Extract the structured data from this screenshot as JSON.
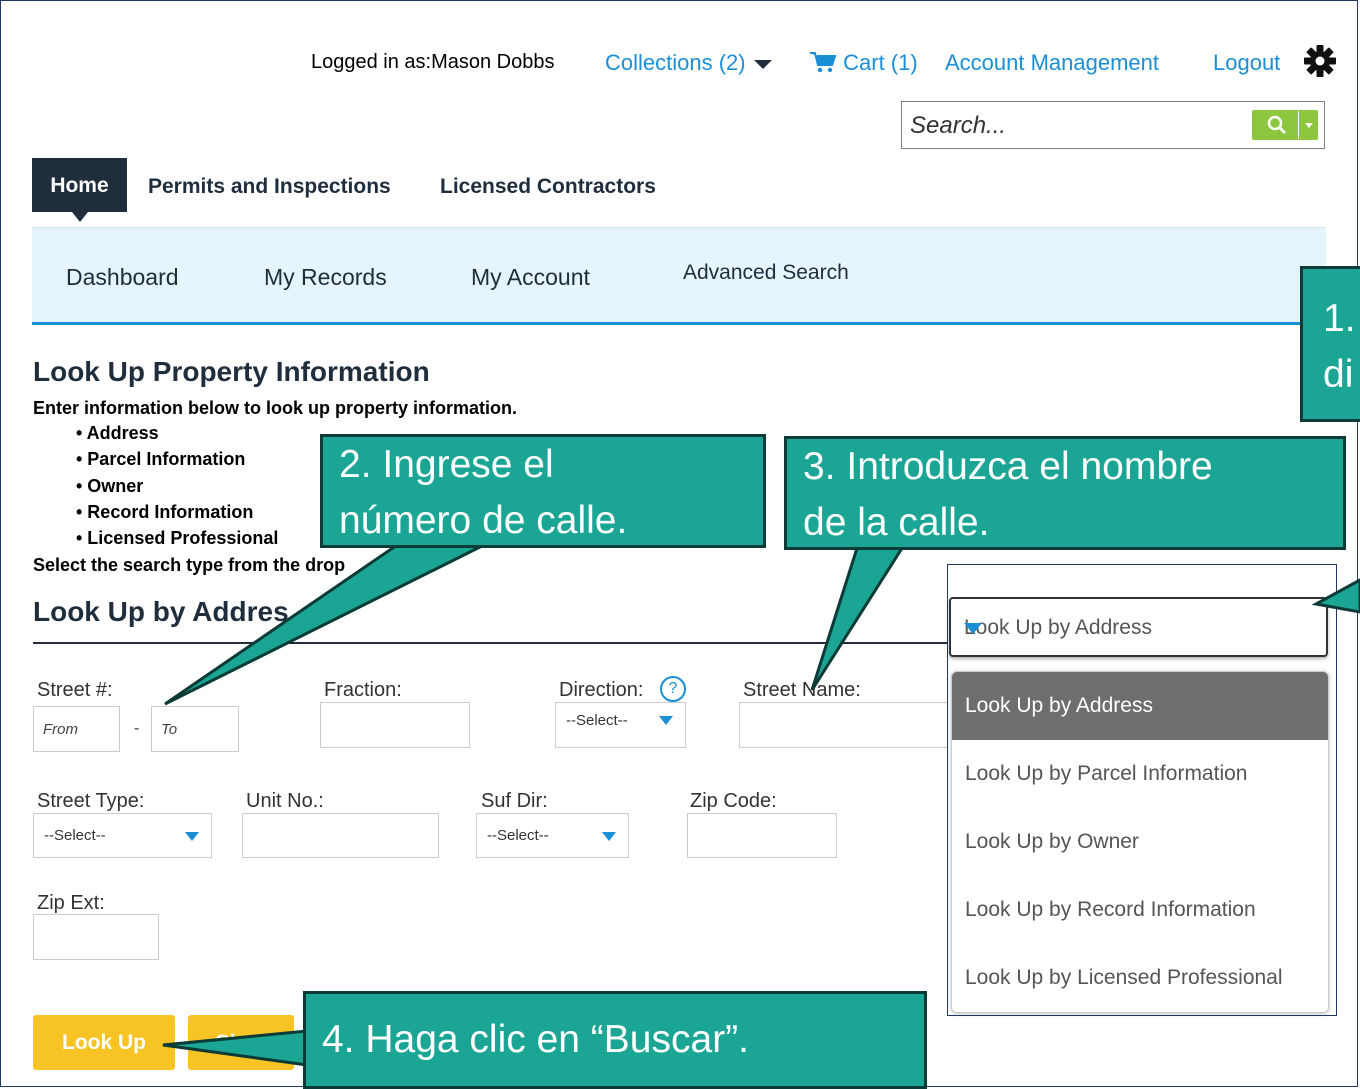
{
  "header": {
    "logged_in": "Logged in as:Mason Dobbs",
    "collections": "Collections (2)",
    "cart": "Cart (1)",
    "account_management": "Account Management",
    "logout": "Logout",
    "search_placeholder": "Search..."
  },
  "nav": {
    "home": "Home",
    "permits": "Permits and Inspections",
    "contractors": "Licensed Contractors"
  },
  "subnav": {
    "dashboard": "Dashboard",
    "my_records": "My Records",
    "my_account": "My Account",
    "advanced_search": "Advanced Search"
  },
  "content": {
    "title": "Look Up Property Information",
    "intro": "Enter information below to look up property information.",
    "bullets": [
      "• Address",
      "• Parcel Information",
      "• Owner",
      "• Record Information",
      "• Licensed Professional"
    ],
    "select_type": "Select the search type from the drop",
    "section_title": "Look Up by Addres"
  },
  "form": {
    "street_no_label": "Street #:",
    "from_placeholder": "From",
    "dash": "-",
    "to_placeholder": "To",
    "fraction_label": "Fraction:",
    "direction_label": "Direction:",
    "direction_value": "--Select--",
    "help": "?",
    "street_name_label": "Street Name:",
    "street_type_label": "Street Type:",
    "street_type_value": "--Select--",
    "unit_label": "Unit No.:",
    "suf_dir_label": "Suf Dir:",
    "suf_dir_value": "--Select--",
    "zip_label": "Zip Code:",
    "zip_ext_label": "Zip Ext:",
    "look_up": "Look Up",
    "clear": "Clear"
  },
  "dropdown": {
    "selected": "Look Up by Address",
    "options": [
      "Look Up by Address",
      "Look Up by Parcel Information",
      "Look Up by Owner",
      "Look Up by Record Information",
      "Look Up by Licensed Professional"
    ]
  },
  "callouts": {
    "c1_line1": "1.",
    "c1_line2": "di",
    "c2_line1": "2. Ingrese el",
    "c2_line2": "número de calle.",
    "c3_line1": "3. Introduzca el nombre",
    "c3_line2": "de la calle.",
    "c4": "4. Haga clic en “Buscar”."
  },
  "colors": {
    "accent": "#1a8fd6",
    "nav_dark": "#1f2d3d",
    "callout": "#1aa595",
    "button": "#f7c325",
    "search_button": "#8dc63f"
  }
}
